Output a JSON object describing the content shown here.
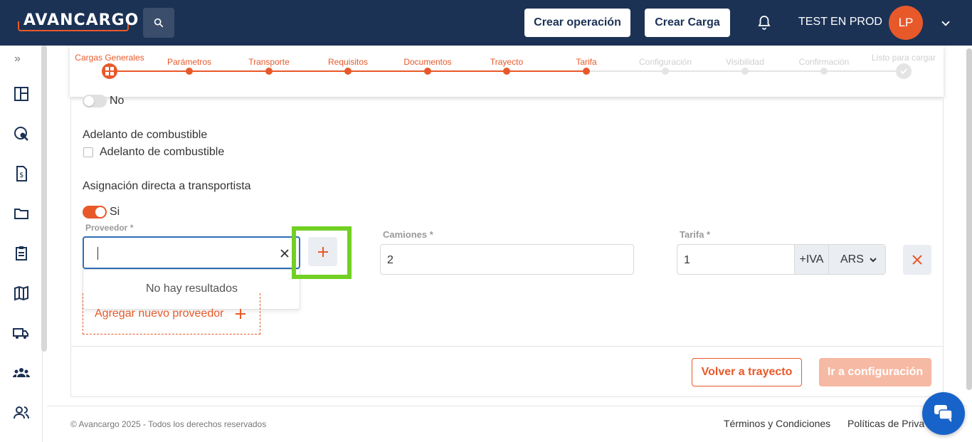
{
  "header": {
    "logo": "AVANCARGO",
    "create_operation": "Crear operación",
    "create_load": "Crear Carga",
    "user_name": "TEST EN PROD",
    "avatar_initials": "LP"
  },
  "stepper": {
    "steps": [
      {
        "label": "Cargas Generales",
        "state": "current"
      },
      {
        "label": "Parámetros",
        "state": "done"
      },
      {
        "label": "Transporte",
        "state": "done"
      },
      {
        "label": "Requisitos",
        "state": "done"
      },
      {
        "label": "Documentos",
        "state": "done"
      },
      {
        "label": "Trayecto",
        "state": "done"
      },
      {
        "label": "Tarifa",
        "state": "done"
      },
      {
        "label": "Configuración",
        "state": "pending"
      },
      {
        "label": "Visibilidad",
        "state": "pending"
      },
      {
        "label": "Confirmación",
        "state": "pending"
      },
      {
        "label": "Listo para cargar",
        "state": "pending"
      }
    ]
  },
  "form": {
    "toggle_no_label": "No",
    "fuel_advance_title": "Adelanto de combustible",
    "fuel_advance_checkbox_label": "Adelanto de combustible",
    "direct_assignment_title": "Asignación directa a transportista",
    "toggle_si_label": "Si",
    "provider_label": "Proveedor *",
    "provider_value": "",
    "no_results": "No hay resultados",
    "add_provider": "Agregar nuevo proveedor",
    "trucks_label": "Camiones *",
    "trucks_value": "2",
    "rate_label": "Tarifa *",
    "rate_value": "1",
    "tax_suffix": "+IVA",
    "currency": "ARS"
  },
  "actions": {
    "back": "Volver a trayecto",
    "next": "Ir a configuración"
  },
  "footer": {
    "copyright": "© Avancargo 2025 - Todos los derechos reservados",
    "terms": "Términos y Condiciones",
    "privacy": "Políticas de Priva"
  },
  "colors": {
    "brand_navy": "#1b3255",
    "accent_orange": "#e8592a",
    "highlight_green": "#72d023"
  }
}
